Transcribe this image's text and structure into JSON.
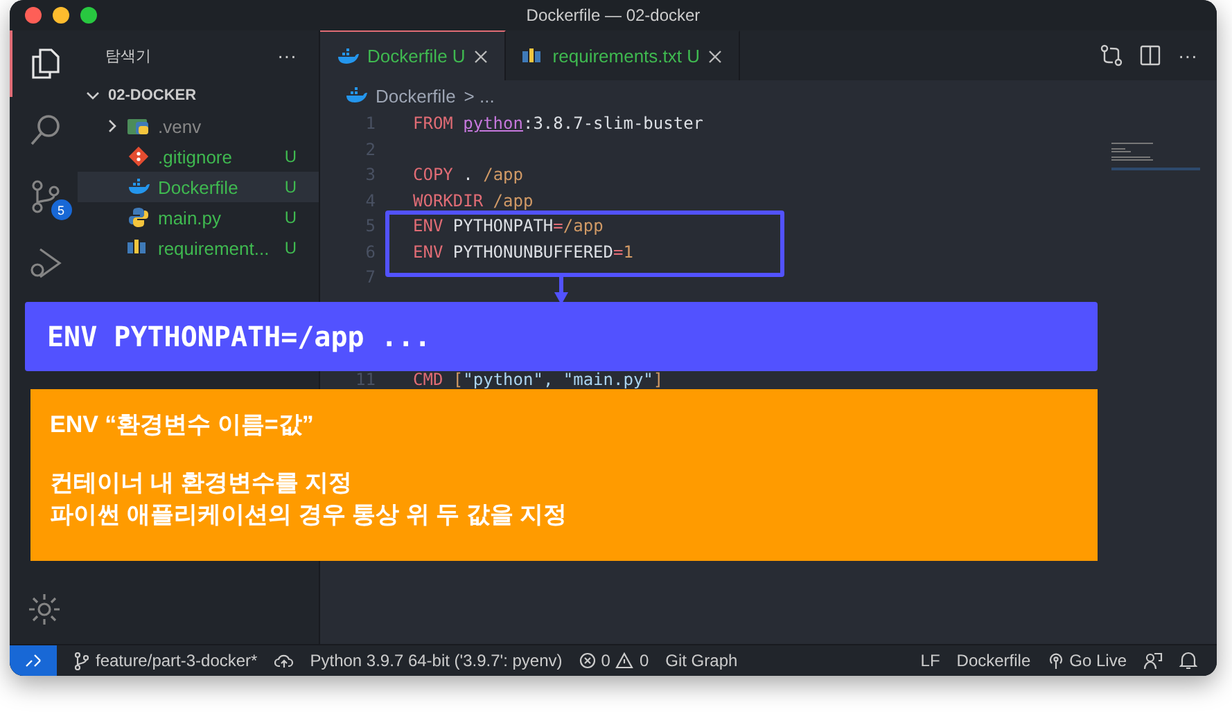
{
  "window": {
    "title": "Dockerfile — 02-docker"
  },
  "activity_bar": [
    {
      "kind": "files",
      "selected": true
    },
    {
      "kind": "search",
      "selected": false
    },
    {
      "kind": "scm",
      "selected": false,
      "badge": "5"
    },
    {
      "kind": "debug",
      "selected": false
    }
  ],
  "sidebar": {
    "title": "탐색기",
    "menu": "···",
    "folder": {
      "name": "02-DOCKER",
      "expanded": true,
      "children": [
        {
          "name": ".venv",
          "kind": "folder",
          "expanded": false,
          "selected": false
        },
        {
          "name": ".gitignore",
          "kind": "git",
          "status": "U",
          "selected": false
        },
        {
          "name": "Dockerfile",
          "kind": "docker",
          "status": "U",
          "selected": true
        },
        {
          "name": "main.py",
          "kind": "python",
          "status": "U",
          "selected": false
        },
        {
          "name": "requirement...",
          "kind": "pip",
          "status": "U",
          "selected": false
        }
      ]
    }
  },
  "tabs": [
    {
      "label": "Dockerfile",
      "kind": "docker",
      "status": "U",
      "selected": true
    },
    {
      "label": "requirements.txt",
      "kind": "pip",
      "status": "U",
      "selected": false
    }
  ],
  "breadcrumb": {
    "file": "Dockerfile",
    "rest": "> ..."
  },
  "code_lines": [
    {
      "number": "1",
      "tokens": [
        {
          "t": "FROM ",
          "kind": "keyword"
        },
        {
          "t": "python",
          "kind": "link"
        },
        {
          "t": ":3.8.7-slim-buster",
          "kind": "plain"
        }
      ]
    },
    {
      "number": "2"
    },
    {
      "number": "3",
      "tokens": [
        {
          "t": "COPY",
          "kind": "keyword"
        },
        {
          "t": " . ",
          "kind": "plain"
        },
        {
          "t": "/app",
          "kind": "value"
        }
      ]
    },
    {
      "number": "4",
      "tokens": [
        {
          "t": "WORKDIR ",
          "kind": "keyword"
        },
        {
          "t": "/app",
          "kind": "value"
        }
      ]
    },
    {
      "number": "5",
      "tokens": [
        {
          "t": "ENV",
          "kind": "keyword"
        },
        {
          "t": " PYTHONPATH",
          "kind": "plain"
        },
        {
          "t": "=",
          "kind": "keyword"
        },
        {
          "t": "/app",
          "kind": "value"
        }
      ]
    },
    {
      "number": "6",
      "tokens": [
        {
          "t": "ENV",
          "kind": "keyword"
        },
        {
          "t": " PYTHONUNBUFFERED",
          "kind": "plain"
        },
        {
          "t": "=",
          "kind": "keyword"
        },
        {
          "t": "1",
          "kind": "value"
        }
      ]
    },
    {
      "number": "7"
    },
    {
      "number": "11",
      "tokens": [
        {
          "t": "CMD ",
          "kind": "keyword"
        },
        {
          "t": "[",
          "kind": "value"
        },
        {
          "t": "\"python\", \"main.py\"",
          "kind": "string"
        },
        {
          "t": "]",
          "kind": "value"
        }
      ]
    }
  ],
  "callout": {
    "title": "ENV PYTHONPATH=/app ...",
    "heading": "ENV “환경변수 이름=값”",
    "lines": [
      "컨테이너 내 환경변수를 지정",
      "파이썬 애플리케이션의 경우 통상 위 두 값을 지정"
    ]
  },
  "status_bar": {
    "branch": "feature/part-3-docker*",
    "interpreter": "Python 3.9.7 64-bit ('3.9.7': pyenv)",
    "errors": "0",
    "warnings": "0",
    "git_graph": "Git Graph",
    "eol": "LF",
    "language": "Dockerfile",
    "go_live": "Go Live"
  }
}
